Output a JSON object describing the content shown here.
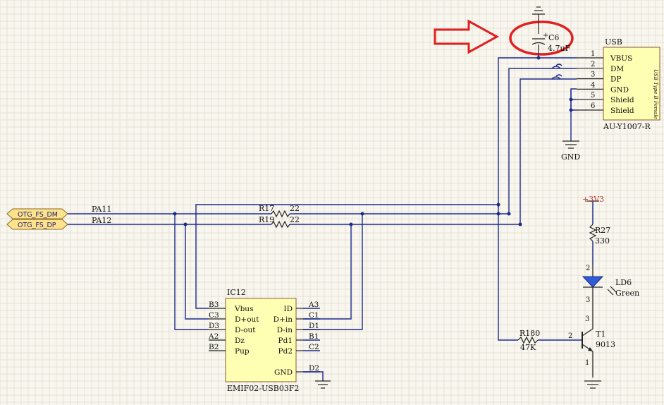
{
  "usb": {
    "ref": "USB",
    "value": "AU-Y1007-R",
    "subtext": "USB Type B Female",
    "pins": [
      {
        "num": "1",
        "name": "VBUS"
      },
      {
        "num": "2",
        "name": "DM"
      },
      {
        "num": "3",
        "name": "DP"
      },
      {
        "num": "4",
        "name": "GND"
      },
      {
        "num": "5",
        "name": "Shield"
      },
      {
        "num": "6",
        "name": "Shield"
      }
    ],
    "gnd_label": "GND"
  },
  "c6": {
    "ref": "C6",
    "value": "4.7uF",
    "polarity": "+"
  },
  "ports": [
    {
      "name": "OTG_FS_DM",
      "net": "PA11"
    },
    {
      "name": "OTG_FS_DP",
      "net": "PA12"
    }
  ],
  "r17": {
    "ref": "R17",
    "value": "22"
  },
  "r19": {
    "ref": "R19",
    "value": "22"
  },
  "ic12": {
    "ref": "IC12",
    "value": "EMIF02-USB03F2",
    "left_pins": [
      {
        "num": "B3",
        "name": "Vbus"
      },
      {
        "num": "C3",
        "name": "D+out"
      },
      {
        "num": "D3",
        "name": "D-out"
      },
      {
        "num": "A2",
        "name": "Dz"
      },
      {
        "num": "B2",
        "name": "Pup"
      }
    ],
    "right_pins": [
      {
        "num": "A3",
        "name": "ID"
      },
      {
        "num": "C1",
        "name": "D+in"
      },
      {
        "num": "D1",
        "name": "D-in"
      },
      {
        "num": "B1",
        "name": "Pd1"
      },
      {
        "num": "C2",
        "name": "Pd2"
      },
      {
        "num": "D2",
        "name": "GND"
      }
    ]
  },
  "power": {
    "label": "+3V3"
  },
  "r27": {
    "ref": "R27",
    "value": "330"
  },
  "ld6": {
    "ref": "LD6",
    "value": "Green",
    "pin_a": "2",
    "pin_k": "3"
  },
  "r180": {
    "ref": "R180",
    "value": "47K"
  },
  "t1": {
    "ref": "T1",
    "value": "9013",
    "pin_b": "2",
    "pin_c": "3",
    "pin_e": "1"
  },
  "colors": {
    "wire": "#1c2a8c",
    "body": "#ffffb4",
    "highlight": "#e02020",
    "background": "#f8f6ee"
  }
}
